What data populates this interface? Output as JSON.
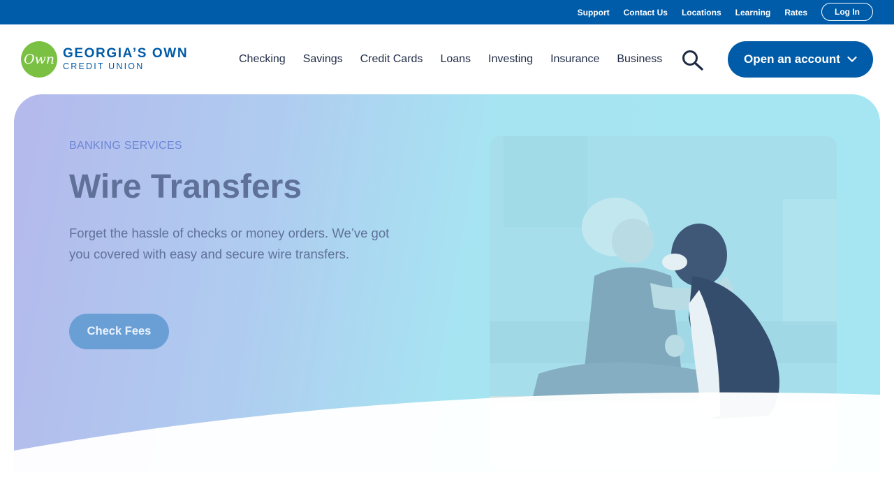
{
  "utility_nav": {
    "links": [
      "Support",
      "Contact Us",
      "Locations",
      "Learning",
      "Rates"
    ],
    "login_label": "Log In"
  },
  "header": {
    "logo": {
      "mark": "Own",
      "line1": "GEORGIA’S OWN",
      "line2": "CREDIT UNION"
    },
    "nav": [
      "Checking",
      "Savings",
      "Credit Cards",
      "Loans",
      "Investing",
      "Insurance",
      "Business"
    ],
    "search_icon": "search-icon",
    "open_account_label": "Open an account"
  },
  "hero": {
    "eyebrow": "BANKING SERVICES",
    "title": "Wire Transfers",
    "description": "Forget the hassle of checks or money orders. We’ve got you covered with easy and secure wire transfers.",
    "cta_label": "Check Fees",
    "image": "woman-with-dog-photo"
  },
  "colors": {
    "brand_blue": "#005ba8",
    "logo_green": "#7ac143",
    "hero_gradient_start": "#b4b9ec",
    "hero_gradient_end": "#a5e6f2",
    "cta_blue": "#6a9fd6"
  }
}
